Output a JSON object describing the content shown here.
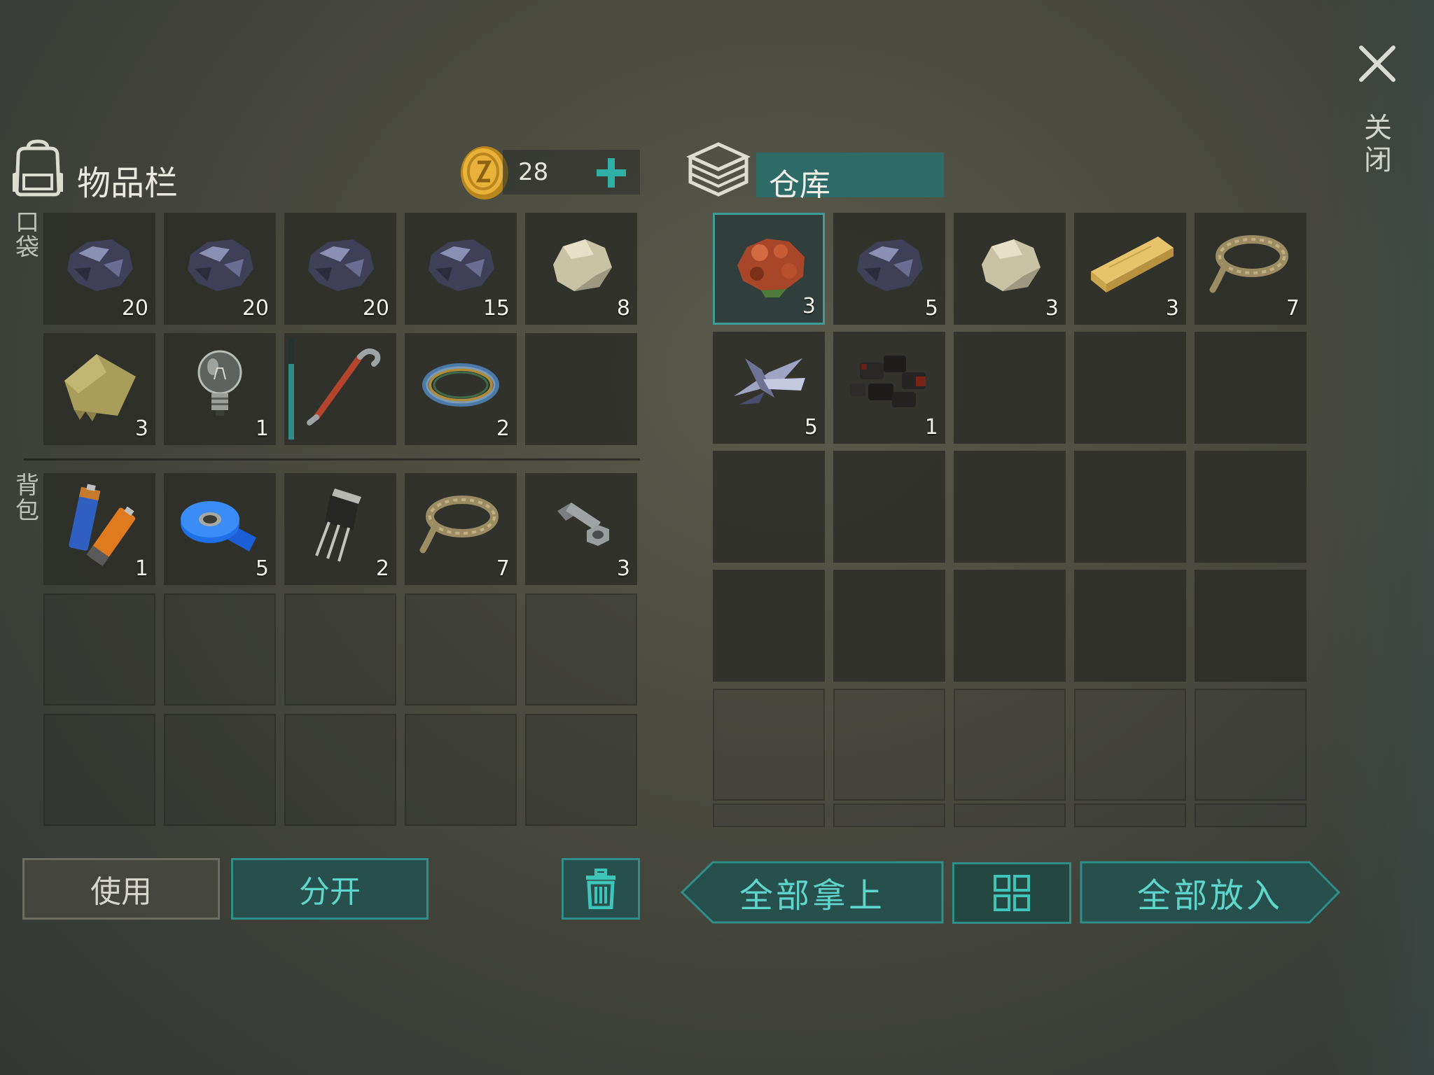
{
  "inventory": {
    "title": "物品栏",
    "coins": "28",
    "pocket_label": "口袋",
    "backpack_label": "背包",
    "pocket_slots": [
      {
        "icon": "coal-ore-icon",
        "qty": "20"
      },
      {
        "icon": "coal-ore-icon",
        "qty": "20"
      },
      {
        "icon": "coal-ore-icon",
        "qty": "20"
      },
      {
        "icon": "coal-ore-icon",
        "qty": "15"
      },
      {
        "icon": "stone-icon",
        "qty": "8"
      },
      {
        "icon": "cloth-icon",
        "qty": "3"
      },
      {
        "icon": "light-bulb-icon",
        "qty": "1"
      },
      {
        "icon": "crowbar-icon",
        "qty": "",
        "durability": 0.75
      },
      {
        "icon": "wire-coil-icon",
        "qty": "2"
      },
      {
        "icon": "",
        "qty": ""
      }
    ],
    "backpack_slots": [
      {
        "icon": "batteries-icon",
        "qty": "1"
      },
      {
        "icon": "tape-icon",
        "qty": "5"
      },
      {
        "icon": "transistor-icon",
        "qty": "2"
      },
      {
        "icon": "rope-icon",
        "qty": "7"
      },
      {
        "icon": "nut-bolt-icon",
        "qty": "3"
      }
    ]
  },
  "warehouse": {
    "title": "仓库",
    "slots": [
      {
        "icon": "copper-ore-icon",
        "qty": "3",
        "selected": true
      },
      {
        "icon": "coal-ore-icon",
        "qty": "5"
      },
      {
        "icon": "stone-icon",
        "qty": "3"
      },
      {
        "icon": "wood-plank-icon",
        "qty": "3"
      },
      {
        "icon": "rope-icon",
        "qty": "7"
      },
      {
        "icon": "metal-scrap-icon",
        "qty": "5"
      },
      {
        "icon": "charcoal-icon",
        "qty": "1"
      }
    ]
  },
  "buttons": {
    "use": "使用",
    "split": "分开",
    "take_all": "全部拿上",
    "put_all": "全部放入"
  },
  "close_label": "关闭",
  "colors": {
    "accent": "#2f8e88",
    "accent_text": "#5fd6cc",
    "panel": "#2f6b66"
  }
}
